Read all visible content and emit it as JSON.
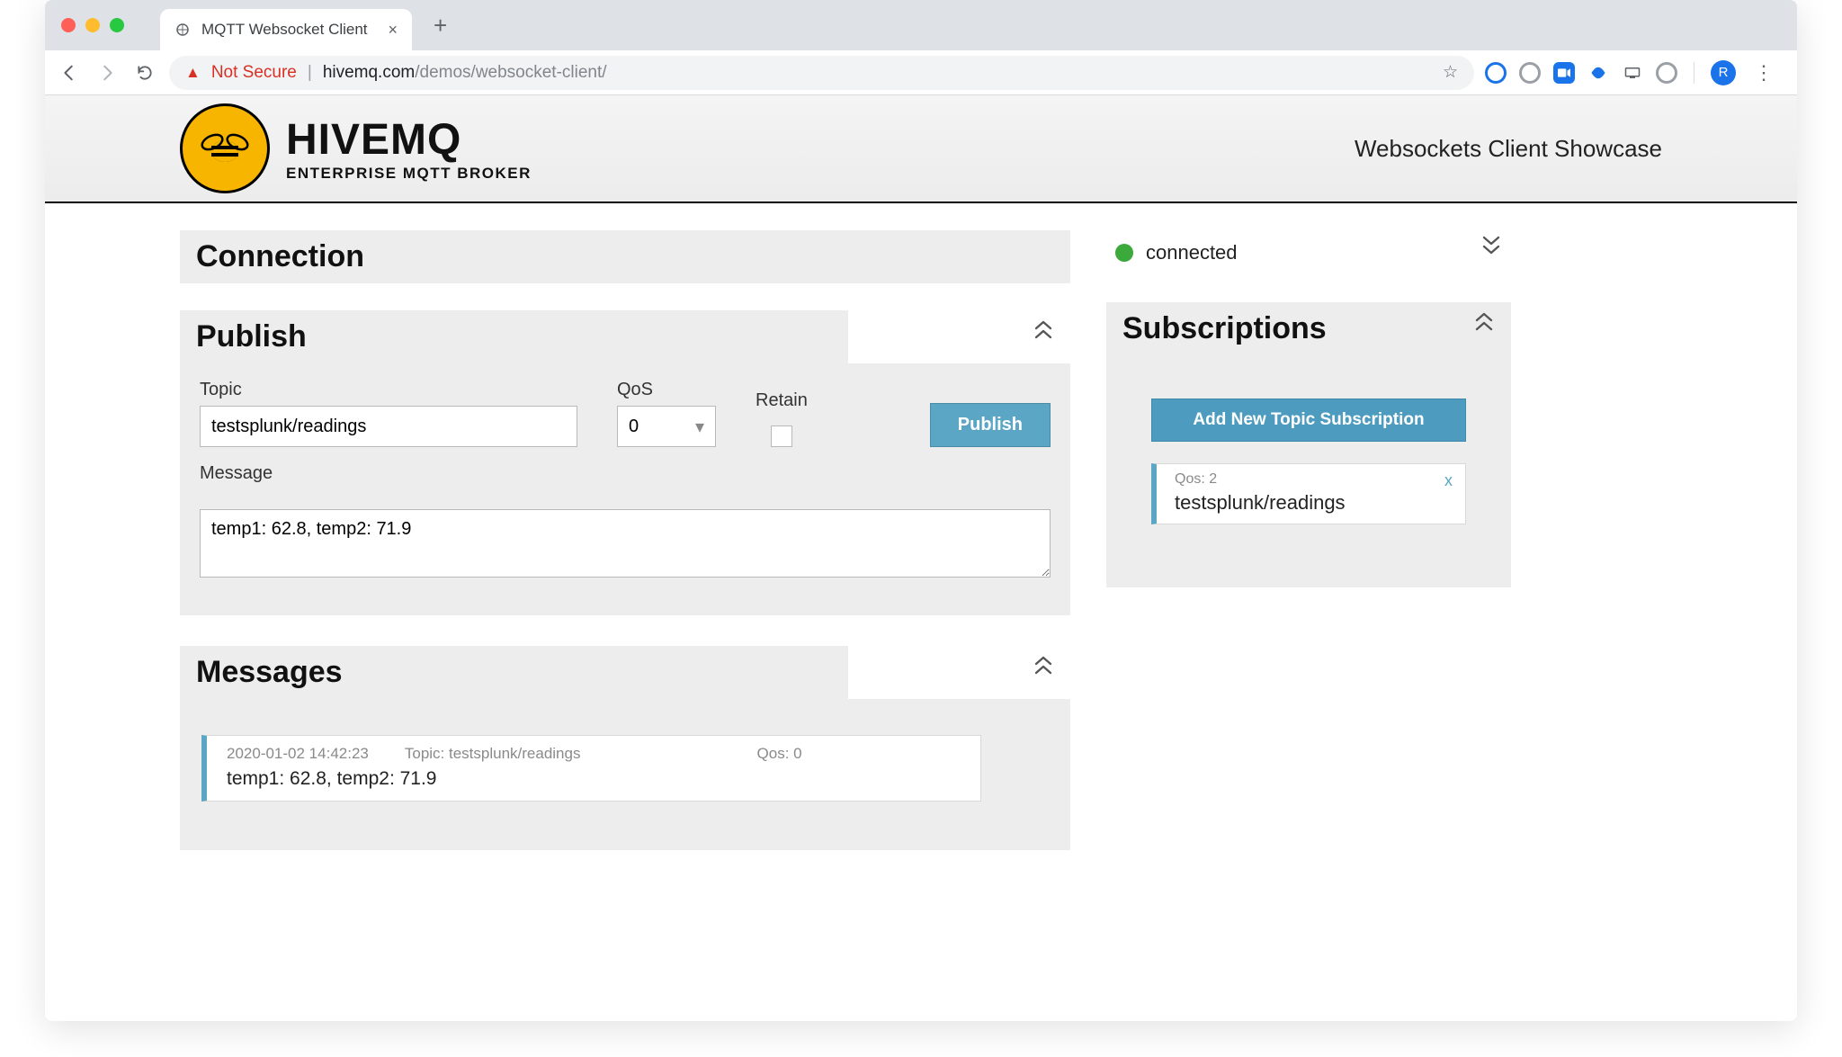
{
  "browser": {
    "tab_title": "MQTT Websocket Client",
    "not_secure_label": "Not Secure",
    "url_host": "hivemq.com",
    "url_path": "/demos/websocket-client/",
    "avatar_letter": "R"
  },
  "header": {
    "brand_name": "HIVEMQ",
    "brand_sub": "ENTERPRISE MQTT BROKER",
    "showcase": "Websockets Client Showcase"
  },
  "connection": {
    "title": "Connection",
    "status_text": "connected",
    "status_color": "#3ba93b"
  },
  "publish": {
    "title": "Publish",
    "topic_label": "Topic",
    "topic_value": "testsplunk/readings",
    "qos_label": "QoS",
    "qos_value": "0",
    "retain_label": "Retain",
    "retain_checked": false,
    "publish_button": "Publish",
    "message_label": "Message",
    "message_value": "temp1: 62.8, temp2: 71.9"
  },
  "subscriptions": {
    "title": "Subscriptions",
    "add_button": "Add New Topic Subscription",
    "items": [
      {
        "qos_label": "Qos: 2",
        "topic": "testsplunk/readings"
      }
    ]
  },
  "messages": {
    "title": "Messages",
    "items": [
      {
        "timestamp": "2020-01-02 14:42:23",
        "topic_label": "Topic: testsplunk/readings",
        "qos_label": "Qos: 0",
        "body": "temp1: 62.8, temp2: 71.9"
      }
    ]
  }
}
